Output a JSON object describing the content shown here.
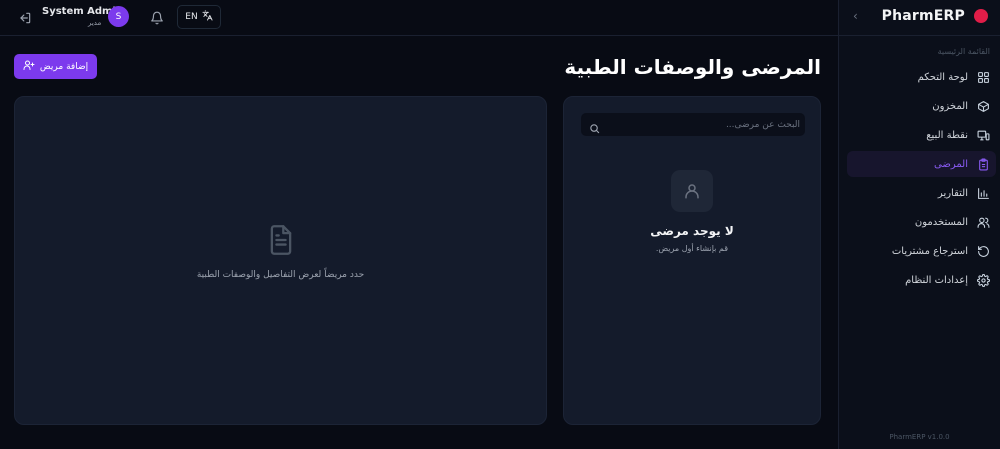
{
  "sidebar": {
    "brand": "PharmERP",
    "section_label": "القائمة الرئيسية",
    "items": [
      {
        "label": "لوحة التحكم",
        "icon": "dashboard-grid-icon",
        "active": false
      },
      {
        "label": "المخزون",
        "icon": "box-icon",
        "active": false
      },
      {
        "label": "نقطة البيع",
        "icon": "monitor-icon",
        "active": false
      },
      {
        "label": "المرضى",
        "icon": "clipboard-icon",
        "active": true
      },
      {
        "label": "التقارير",
        "icon": "bar-chart-icon",
        "active": false
      },
      {
        "label": "المستخدمون",
        "icon": "users-icon",
        "active": false
      },
      {
        "label": "استرجاع مشتريات",
        "icon": "rotate-icon",
        "active": false
      },
      {
        "label": "إعدادات النظام",
        "icon": "gear-icon",
        "active": false
      }
    ],
    "version": "PharmERP v1.0.0"
  },
  "header": {
    "user_name": "System Admin",
    "user_role": "مدير",
    "avatar_initial": "S",
    "language": "EN"
  },
  "main": {
    "title": "المرضى والوصفات الطبية",
    "add_button_label": "إضافة مريض",
    "search_placeholder": "البحث عن مرضى...",
    "empty_title": "لا يوجد مرضى",
    "empty_subtitle": "قم بإنشاء أول مريض.",
    "detail_hint": "حدد مريضاً لعرض التفاصيل والوصفات الطبية"
  },
  "colors": {
    "accent": "#7c3aed",
    "brand_dot": "#e11d48",
    "background": "#080b14",
    "panel": "#141b2b"
  }
}
